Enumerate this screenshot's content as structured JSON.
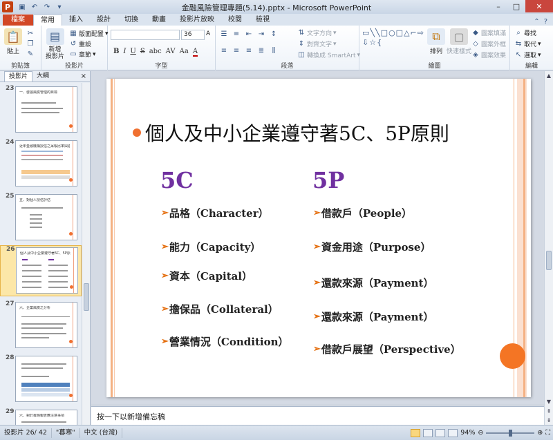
{
  "window": {
    "title": "金融風險管理專題(5.14).pptx - Microsoft PowerPoint",
    "app_icon": "P",
    "controls": [
      "–",
      "□",
      "✕"
    ]
  },
  "quick_access": [
    "save-icon",
    "undo-icon",
    "redo-icon"
  ],
  "ribbon_tabs": [
    "檔案",
    "常用",
    "插入",
    "設計",
    "切換",
    "動畫",
    "投影片放映",
    "校閱",
    "檢視"
  ],
  "ribbon": {
    "clipboard": {
      "paste": "貼上",
      "label": "剪貼簿"
    },
    "slides": {
      "new_slide": "新增\n投影片",
      "layout": "版面配置",
      "reset": "重設",
      "section": "章節",
      "label": "投影片"
    },
    "font": {
      "font_name": "",
      "font_size": "36",
      "bold": "B",
      "italic": "I",
      "underline": "U",
      "strike": "S",
      "shadow": "abc",
      "spacing": "AV",
      "case": "Aa",
      "color": "A",
      "label": "字型"
    },
    "paragraph": {
      "text_direction": "文字方向",
      "align_text": "對齊文字",
      "smartart": "轉換成 SmartArt",
      "label": "段落"
    },
    "drawing": {
      "arrange": "排列",
      "quick_styles": "快速樣式",
      "shape_fill": "圖案填滿",
      "shape_outline": "圖案外框",
      "shape_effects": "圖案效果",
      "label": "繪圖"
    },
    "editing": {
      "find": "尋找",
      "replace": "取代",
      "select": "選取",
      "label": "編輯"
    }
  },
  "panel": {
    "tabs": [
      "投影片",
      "大綱"
    ],
    "close": "×",
    "thumbnails": [
      {
        "num": "23",
        "title": "一、發展風險管理的目標"
      },
      {
        "num": "24",
        "title": "近年金融機構授信之呆帳比率與逾放比"
      },
      {
        "num": "25",
        "title": "五、對個人授信評估"
      },
      {
        "num": "26",
        "title": "個人及中小企業遵守著5C、5P原則"
      },
      {
        "num": "27",
        "title": "六、企業風險之分析"
      },
      {
        "num": "28",
        "title": ""
      },
      {
        "num": "29",
        "title": "六、對於專題報告應注意事項"
      }
    ]
  },
  "slide": {
    "title": "個人及中小企業遵守著5C、5P原則",
    "col_left": {
      "heading": "5C",
      "items": [
        "品格（Character）",
        "能力（Capacity）",
        "資本（Capital）",
        "擔保品（Collateral）",
        "營業情況（Condition）"
      ]
    },
    "col_right": {
      "heading": "5P",
      "items": [
        "借款戶（People）",
        "資金用途（Purpose）",
        "還款來源（Payment）",
        "還款來源（Payment）",
        "借款戶展望（Perspective）"
      ]
    },
    "arrow_glyph": "➢",
    "colors": {
      "heading": "#7030a0",
      "bullet": "#f07030",
      "accent_stripe": "#f4b183"
    }
  },
  "notes": {
    "placeholder": "按一下以新增備忘稿"
  },
  "status": {
    "slide_pos": "投影片 26/ 42",
    "theme": "\"暮寒\"",
    "language": "中文 (台灣)",
    "zoom": "94%"
  }
}
